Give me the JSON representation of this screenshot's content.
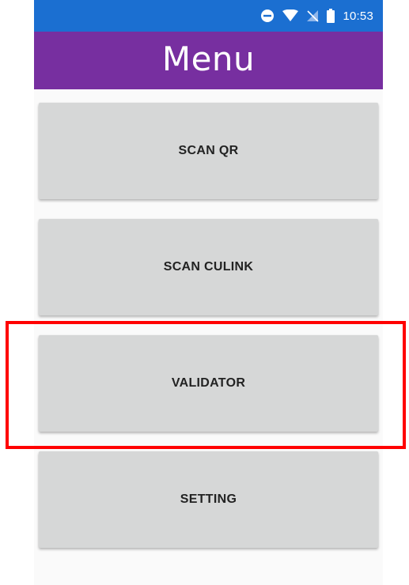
{
  "status_bar": {
    "time": "10:53",
    "icons": [
      "do-not-disturb-icon",
      "wifi-icon",
      "no-sim-icon",
      "battery-icon"
    ],
    "background": "#1b6fd1"
  },
  "app_bar": {
    "title": "Menu",
    "background": "#772fa0"
  },
  "menu": {
    "items": [
      {
        "label": "SCAN QR"
      },
      {
        "label": "SCAN CULINK"
      },
      {
        "label": "VALIDATOR",
        "highlighted": true
      },
      {
        "label": "SETTING"
      }
    ],
    "button_color": "#d6d7d7"
  },
  "highlight": {
    "color": "#ff0000"
  }
}
